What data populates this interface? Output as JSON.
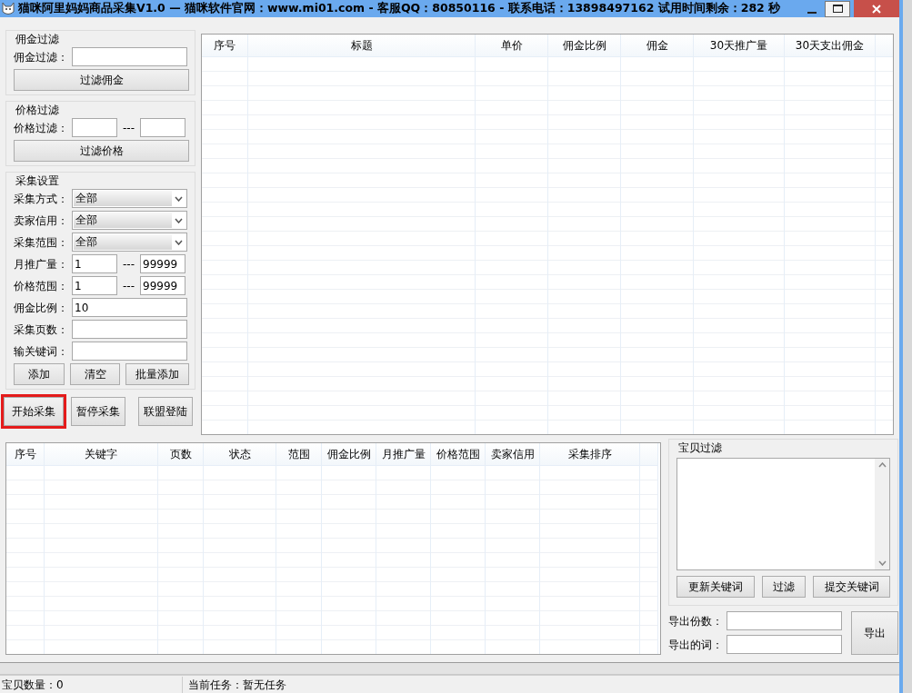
{
  "window": {
    "title": "猫咪阿里妈妈商品采集V1.0 — 猫咪软件官网：www.mi01.com - 客服QQ：80850116 - 联系电话：13898497162  试用时间剩余：282 秒"
  },
  "commission_filter": {
    "title": "佣金过滤",
    "label": "佣金过滤：",
    "button": "过滤佣金"
  },
  "price_filter": {
    "title": "价格过滤",
    "label": "价格过滤：",
    "separator": "---",
    "button": "过滤价格"
  },
  "collect_settings": {
    "title": "采集设置",
    "fields": [
      {
        "kind": "select",
        "label": "采集方式：",
        "value": "全部"
      },
      {
        "kind": "select",
        "label": "卖家信用：",
        "value": "全部"
      },
      {
        "kind": "select",
        "label": "采集范围：",
        "value": "全部"
      },
      {
        "kind": "range",
        "label": "月推广量：",
        "from": "1",
        "separator": "---",
        "to": "99999"
      },
      {
        "kind": "range",
        "label": "价格范围：",
        "from": "1",
        "separator": "---",
        "to": "99999"
      },
      {
        "kind": "text",
        "label": "佣金比例：",
        "value": "10"
      },
      {
        "kind": "text",
        "label": "采集页数："
      },
      {
        "kind": "text",
        "label": "输关键词："
      }
    ],
    "buttons": [
      "添加",
      "清空",
      "批量添加"
    ]
  },
  "actions": [
    {
      "label": "开始采集",
      "highlighted": true
    },
    {
      "label": "暂停采集",
      "highlighted": false
    },
    {
      "label": "联盟登陆",
      "highlighted": false
    }
  ],
  "product_table": {
    "columns": [
      "序号",
      "标题",
      "单价",
      "佣金比例",
      "佣金",
      "30天推广量",
      "30天支出佣金"
    ]
  },
  "keyword_table": {
    "columns": [
      "序号",
      "关键字",
      "页数",
      "状态",
      "范围",
      "佣金比例",
      "月推广量",
      "价格范围",
      "卖家信用",
      "采集排序"
    ]
  },
  "item_filter": {
    "title": "宝贝过滤",
    "buttons": [
      "更新关键词",
      "过滤",
      "提交关键词"
    ]
  },
  "export": {
    "fields": [
      {
        "label": "导出份数："
      },
      {
        "label": "导出的词："
      }
    ],
    "button": "导出"
  },
  "status_bar": {
    "count": "宝贝数量：0",
    "task": "当前任务：暂无任务"
  }
}
